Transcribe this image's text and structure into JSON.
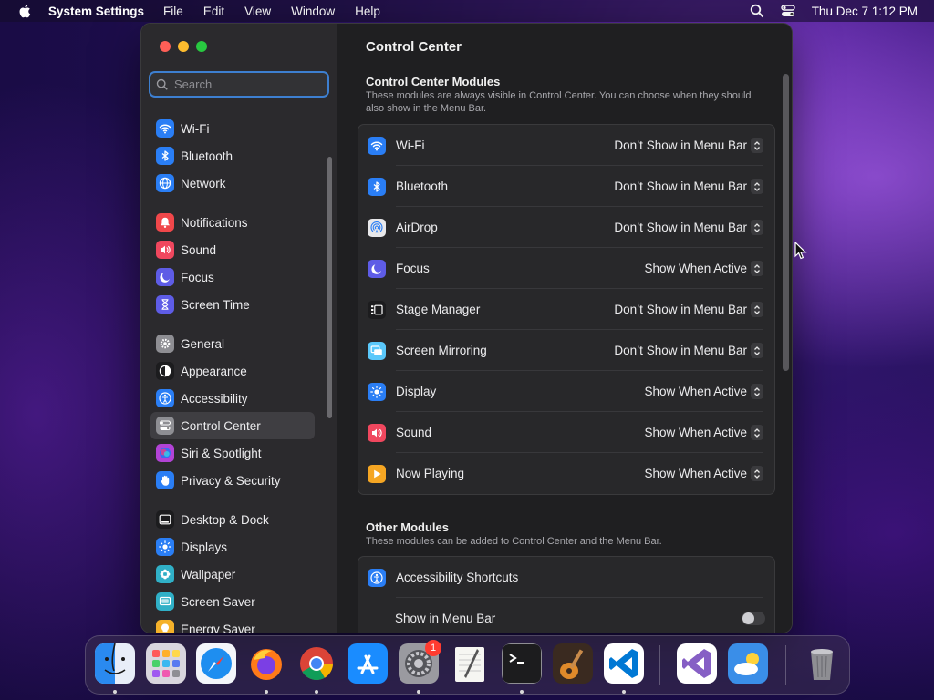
{
  "menubar": {
    "app_name": "System Settings",
    "menus": [
      "File",
      "Edit",
      "View",
      "Window",
      "Help"
    ],
    "clock": "Thu Dec 7  1:12 PM"
  },
  "window": {
    "title": "Control Center",
    "sidebar": {
      "search_placeholder": "Search",
      "groups": [
        [
          {
            "label": "Wi-Fi",
            "icon": "wifi-icon",
            "color": "#2a7ef5"
          },
          {
            "label": "Bluetooth",
            "icon": "bluetooth-icon",
            "color": "#2a7ef5"
          },
          {
            "label": "Network",
            "icon": "globe-icon",
            "color": "#2a7ef5"
          }
        ],
        [
          {
            "label": "Notifications",
            "icon": "bell-icon",
            "color": "#f0474a"
          },
          {
            "label": "Sound",
            "icon": "speaker-icon",
            "color": "#f0475e"
          },
          {
            "label": "Focus",
            "icon": "moon-icon",
            "color": "#5e5ce6"
          },
          {
            "label": "Screen Time",
            "icon": "hourglass-icon",
            "color": "#5e5ce6"
          }
        ],
        [
          {
            "label": "General",
            "icon": "gear-icon",
            "color": "#8e8e93"
          },
          {
            "label": "Appearance",
            "icon": "appearance-icon",
            "color": "#1c1c1e"
          },
          {
            "label": "Accessibility",
            "icon": "accessibility-icon",
            "color": "#2a7ef5"
          },
          {
            "label": "Control Center",
            "icon": "control-center-icon",
            "color": "#8e8e93",
            "selected": true
          },
          {
            "label": "Siri & Spotlight",
            "icon": "siri-icon",
            "color": "#b243d6"
          },
          {
            "label": "Privacy & Security",
            "icon": "hand-icon",
            "color": "#2a7ef5"
          }
        ],
        [
          {
            "label": "Desktop & Dock",
            "icon": "dock-icon",
            "color": "#1c1c1e"
          },
          {
            "label": "Displays",
            "icon": "sun-icon",
            "color": "#2a7ef5"
          },
          {
            "label": "Wallpaper",
            "icon": "wallpaper-icon",
            "color": "#30b0c7"
          },
          {
            "label": "Screen Saver",
            "icon": "screensaver-icon",
            "color": "#30b0c7"
          },
          {
            "label": "Energy Saver",
            "icon": "bulb-icon",
            "color": "#f5b22a"
          }
        ]
      ]
    },
    "modules_section": {
      "title": "Control Center Modules",
      "description": "These modules are always visible in Control Center. You can choose when they should also show in the Menu Bar.",
      "rows": [
        {
          "label": "Wi-Fi",
          "icon": "wifi-icon",
          "color": "#2a7ef5",
          "value": "Don’t Show in Menu Bar"
        },
        {
          "label": "Bluetooth",
          "icon": "bluetooth-icon",
          "color": "#2a7ef5",
          "value": "Don’t Show in Menu Bar"
        },
        {
          "label": "AirDrop",
          "icon": "airdrop-icon",
          "color": "#e8e8ea",
          "value": "Don’t Show in Menu Bar"
        },
        {
          "label": "Focus",
          "icon": "moon-icon",
          "color": "#5e5ce6",
          "value": "Show When Active"
        },
        {
          "label": "Stage Manager",
          "icon": "stage-manager-icon",
          "color": "#1c1c1e",
          "value": "Don’t Show in Menu Bar"
        },
        {
          "label": "Screen Mirroring",
          "icon": "screen-mirroring-icon",
          "color": "#5ac8fa",
          "value": "Don’t Show in Menu Bar"
        },
        {
          "label": "Display",
          "icon": "sun-icon",
          "color": "#2a7ef5",
          "value": "Show When Active"
        },
        {
          "label": "Sound",
          "icon": "speaker-icon",
          "color": "#f0475e",
          "value": "Show When Active"
        },
        {
          "label": "Now Playing",
          "icon": "play-icon",
          "color": "#f5a623",
          "value": "Show When Active"
        }
      ]
    },
    "other_section": {
      "title": "Other Modules",
      "description": "These modules can be added to Control Center and the Menu Bar.",
      "rows": [
        {
          "label": "Accessibility Shortcuts",
          "icon": "accessibility-icon",
          "color": "#2a7ef5"
        }
      ],
      "toggle": {
        "label": "Show in Menu Bar",
        "on": false
      }
    }
  },
  "dock": {
    "apps": [
      {
        "name": "finder-icon",
        "color": "#3a9df5",
        "running": true
      },
      {
        "name": "launchpad-icon",
        "color": "#e6e3ea",
        "running": false
      },
      {
        "name": "safari-icon",
        "color": "#1e8ef0",
        "running": false
      },
      {
        "name": "firefox-icon",
        "color": "#ff7a18",
        "running": true
      },
      {
        "name": "chrome-icon",
        "color": "#ffffff",
        "running": true
      },
      {
        "name": "app-store-icon",
        "color": "#1a8cff",
        "running": false
      },
      {
        "name": "system-settings-icon",
        "color": "#8e8e93",
        "running": true,
        "badge": "1"
      },
      {
        "name": "textedit-icon",
        "color": "#f4f4f0",
        "running": false
      },
      {
        "name": "terminal-icon",
        "color": "#1c1c1e",
        "running": true
      },
      {
        "name": "garageband-icon",
        "color": "#3a2a20",
        "running": false
      },
      {
        "name": "vscode-icon",
        "color": "#ffffff",
        "running": true
      },
      {
        "name": "visual-studio-icon",
        "color": "#ffffff",
        "running": false
      },
      {
        "name": "weather-icon",
        "color": "#3a8ee8",
        "running": false
      },
      {
        "name": "trash-icon",
        "color": "#6e6e73",
        "running": false
      }
    ]
  }
}
